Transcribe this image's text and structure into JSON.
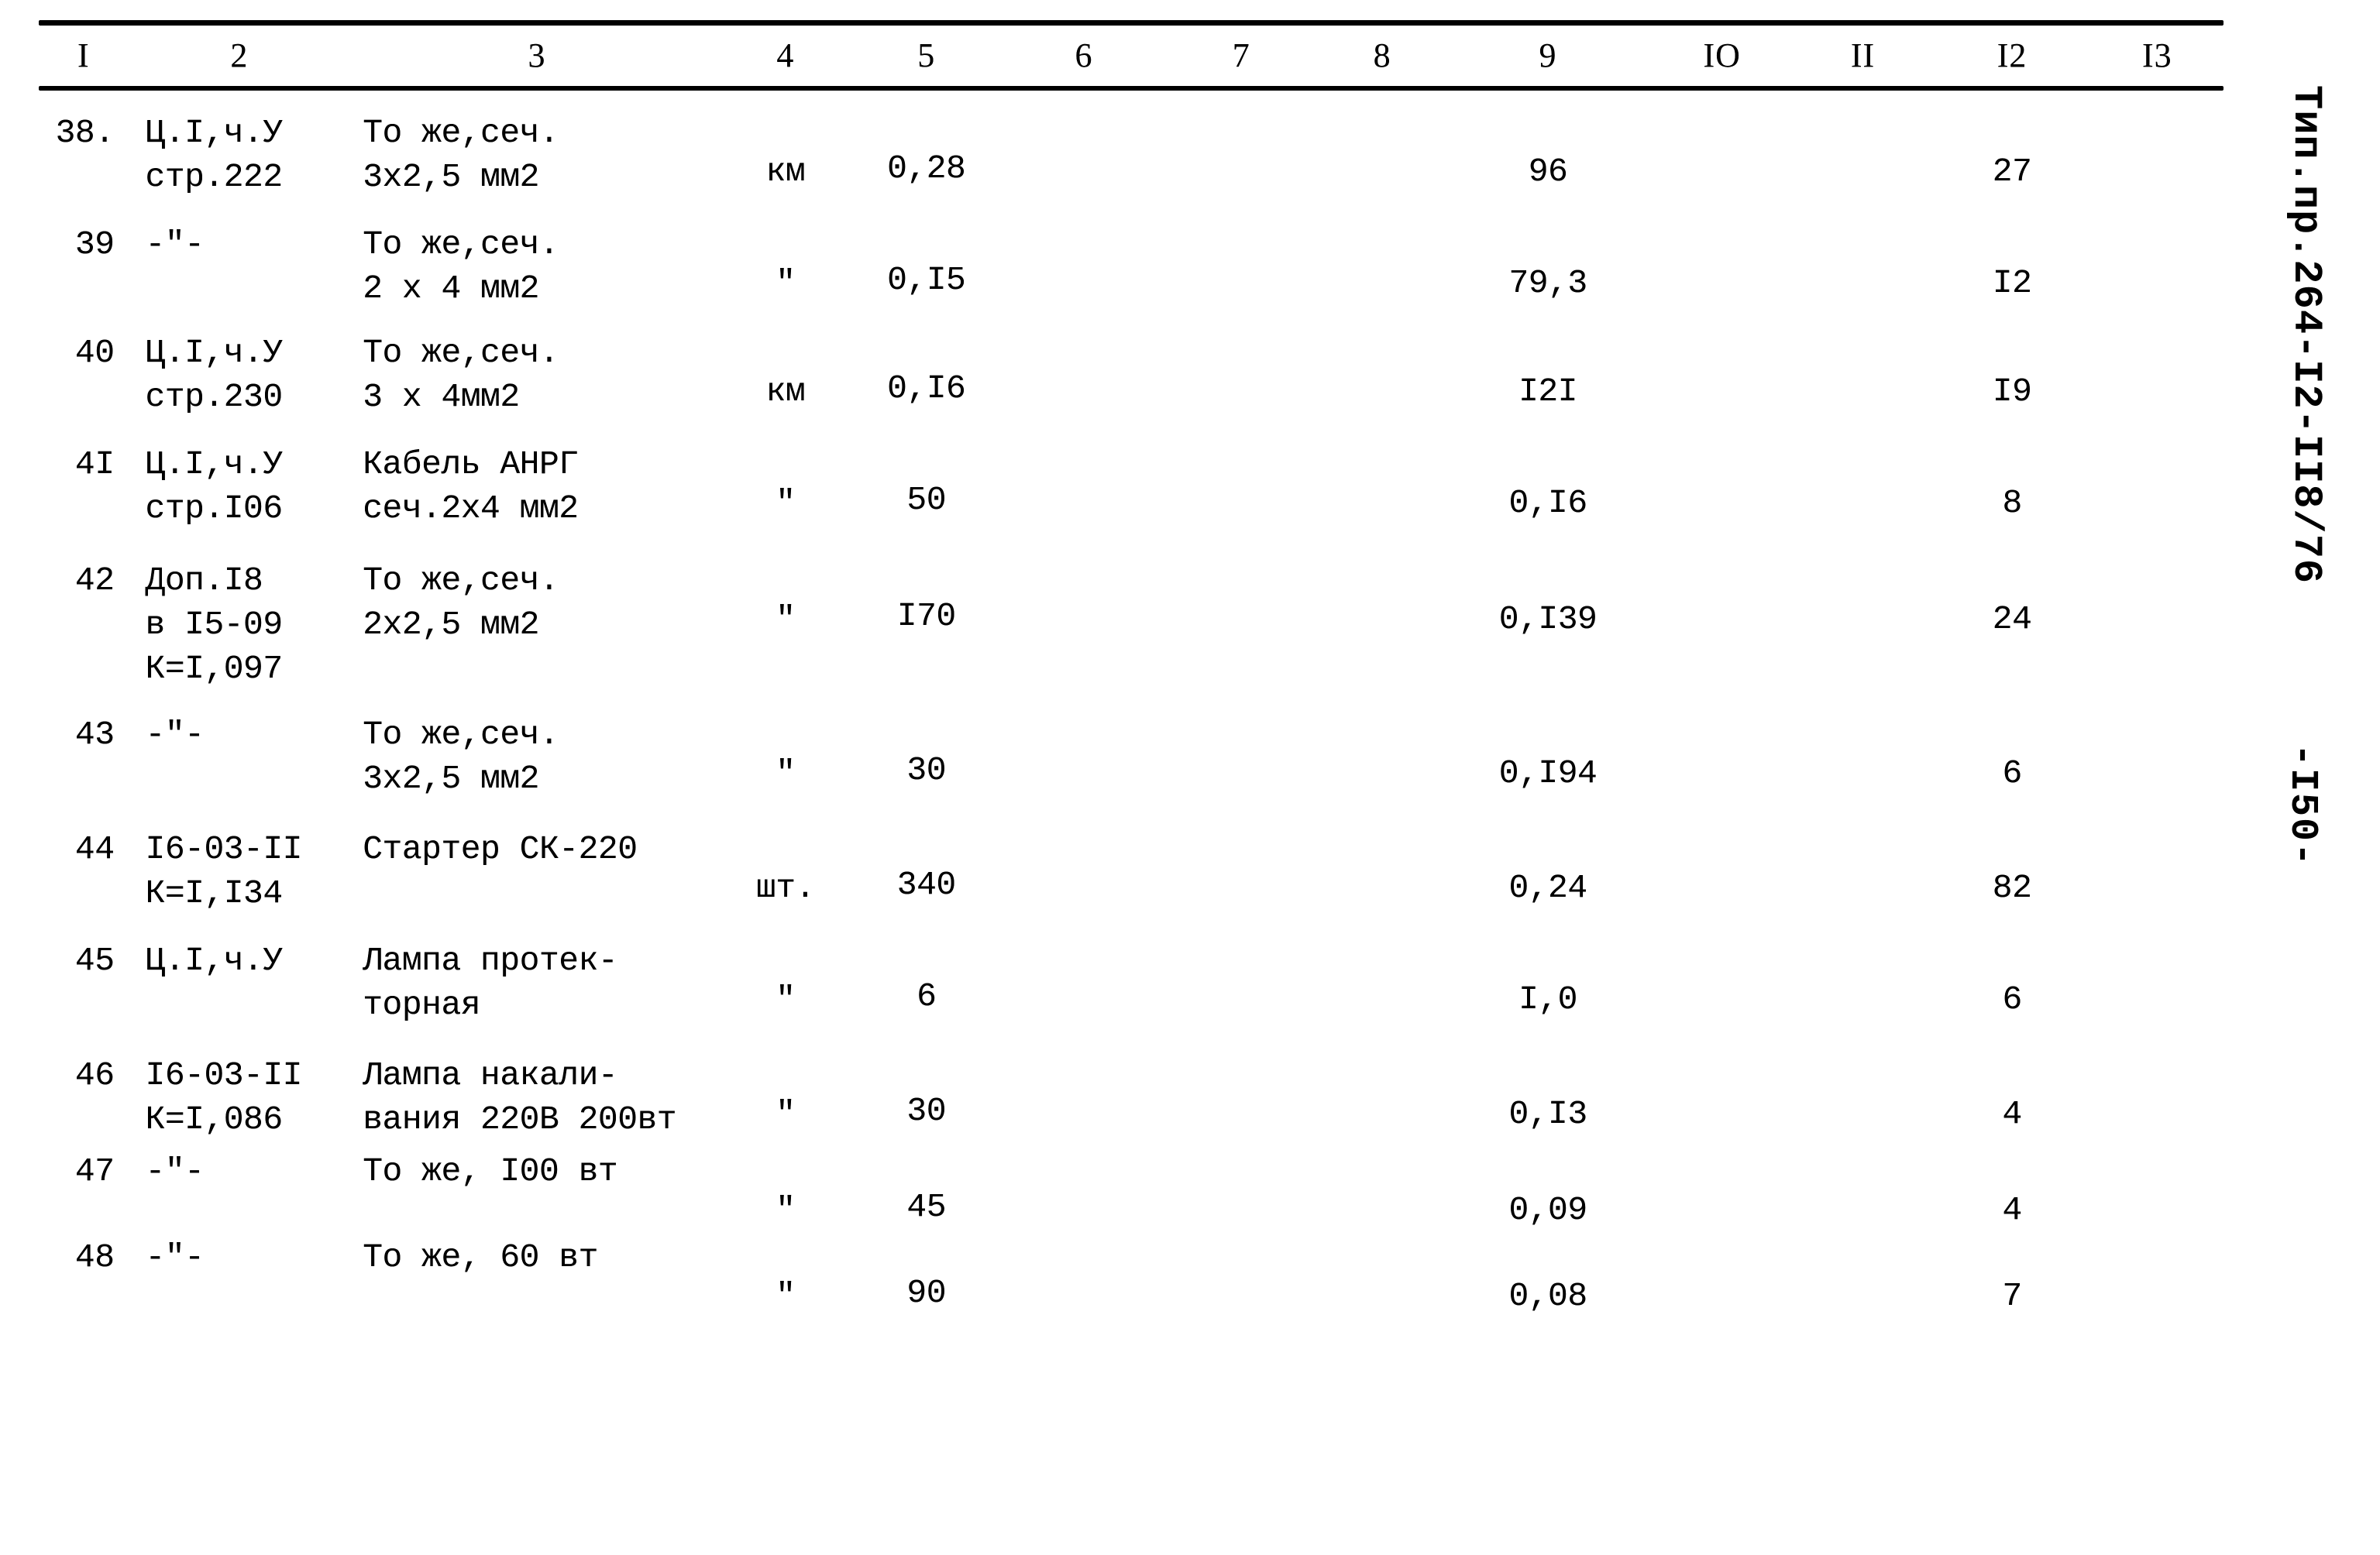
{
  "document": {
    "code_label": "Тип.пр.264-I2-II8/76",
    "page_label": "-I50-"
  },
  "table": {
    "column_headers": [
      "I",
      "2",
      "3",
      "4",
      "5",
      "6",
      "7",
      "8",
      "9",
      "IO",
      "II",
      "I2",
      "I3"
    ],
    "rows": [
      {
        "no": "38.",
        "ref": "Ц.I,ч.У\nстр.222",
        "description": "То же,сеч.\n3х2,5 мм2",
        "unit": "км",
        "c5": "0,28",
        "c6": "",
        "c7": "",
        "c8": "",
        "c9": "96",
        "c10": "",
        "c11": "",
        "c12": "27",
        "c13": ""
      },
      {
        "no": "39",
        "ref": "-\"-",
        "description": "То же,сеч.\n2 х 4 мм2",
        "unit": "\"",
        "c5": "0,I5",
        "c6": "",
        "c7": "",
        "c8": "",
        "c9": "79,3",
        "c10": "",
        "c11": "",
        "c12": "I2",
        "c13": ""
      },
      {
        "no": "40",
        "ref": "Ц.I,ч.У\nстр.230",
        "description": "То же,сеч.\n3 х 4мм2",
        "unit": "км",
        "c5": "0,I6",
        "c6": "",
        "c7": "",
        "c8": "",
        "c9": "I2I",
        "c10": "",
        "c11": "",
        "c12": "I9",
        "c13": ""
      },
      {
        "no": "4I",
        "ref": "Ц.I,ч.У\nстр.I06",
        "description": "Кабель АНРГ\nсеч.2х4 мм2",
        "unit": "\"",
        "c5": "50",
        "c6": "",
        "c7": "",
        "c8": "",
        "c9": "0,I6",
        "c10": "",
        "c11": "",
        "c12": "8",
        "c13": ""
      },
      {
        "no": "42",
        "ref": "Доп.I8\nв I5-09\nК=I,097",
        "description": "То же,сеч.\n2х2,5 мм2",
        "unit": "\"",
        "c5": "I70",
        "c6": "",
        "c7": "",
        "c8": "",
        "c9": "0,I39",
        "c10": "",
        "c11": "",
        "c12": "24",
        "c13": ""
      },
      {
        "no": "43",
        "ref": "-\"-",
        "description": "То же,сеч.\n3х2,5 мм2",
        "unit": "\"",
        "c5": "30",
        "c6": "",
        "c7": "",
        "c8": "",
        "c9": "0,I94",
        "c10": "",
        "c11": "",
        "c12": "6",
        "c13": ""
      },
      {
        "no": "44",
        "ref": "I6-03-II\nК=I,I34",
        "description": "Стартер СК-220",
        "unit": "шт.",
        "c5": "340",
        "c6": "",
        "c7": "",
        "c8": "",
        "c9": "0,24",
        "c10": "",
        "c11": "",
        "c12": "82",
        "c13": ""
      },
      {
        "no": "45",
        "ref": "Ц.I,ч.У",
        "description": "Лампа протек-\nторная",
        "unit": "\"",
        "c5": "6",
        "c6": "",
        "c7": "",
        "c8": "",
        "c9": "I,0",
        "c10": "",
        "c11": "",
        "c12": "6",
        "c13": ""
      },
      {
        "no": "46",
        "ref": "I6-03-II\nК=I,086",
        "description": "Лампа накали-\nвания 220В 200вт",
        "unit": "\"",
        "c5": "30",
        "c6": "",
        "c7": "",
        "c8": "",
        "c9": "0,I3",
        "c10": "",
        "c11": "",
        "c12": "4",
        "c13": ""
      },
      {
        "no": "47",
        "ref": "-\"-",
        "description": "То же, I00 вт",
        "unit": "\"",
        "c5": "45",
        "c6": "",
        "c7": "",
        "c8": "",
        "c9": "0,09",
        "c10": "",
        "c11": "",
        "c12": "4",
        "c13": ""
      },
      {
        "no": "48",
        "ref": "-\"-",
        "description": "То же, 60 вт",
        "unit": "\"",
        "c5": "90",
        "c6": "",
        "c7": "",
        "c8": "",
        "c9": "0,08",
        "c10": "",
        "c11": "",
        "c12": "7",
        "c13": ""
      }
    ]
  }
}
